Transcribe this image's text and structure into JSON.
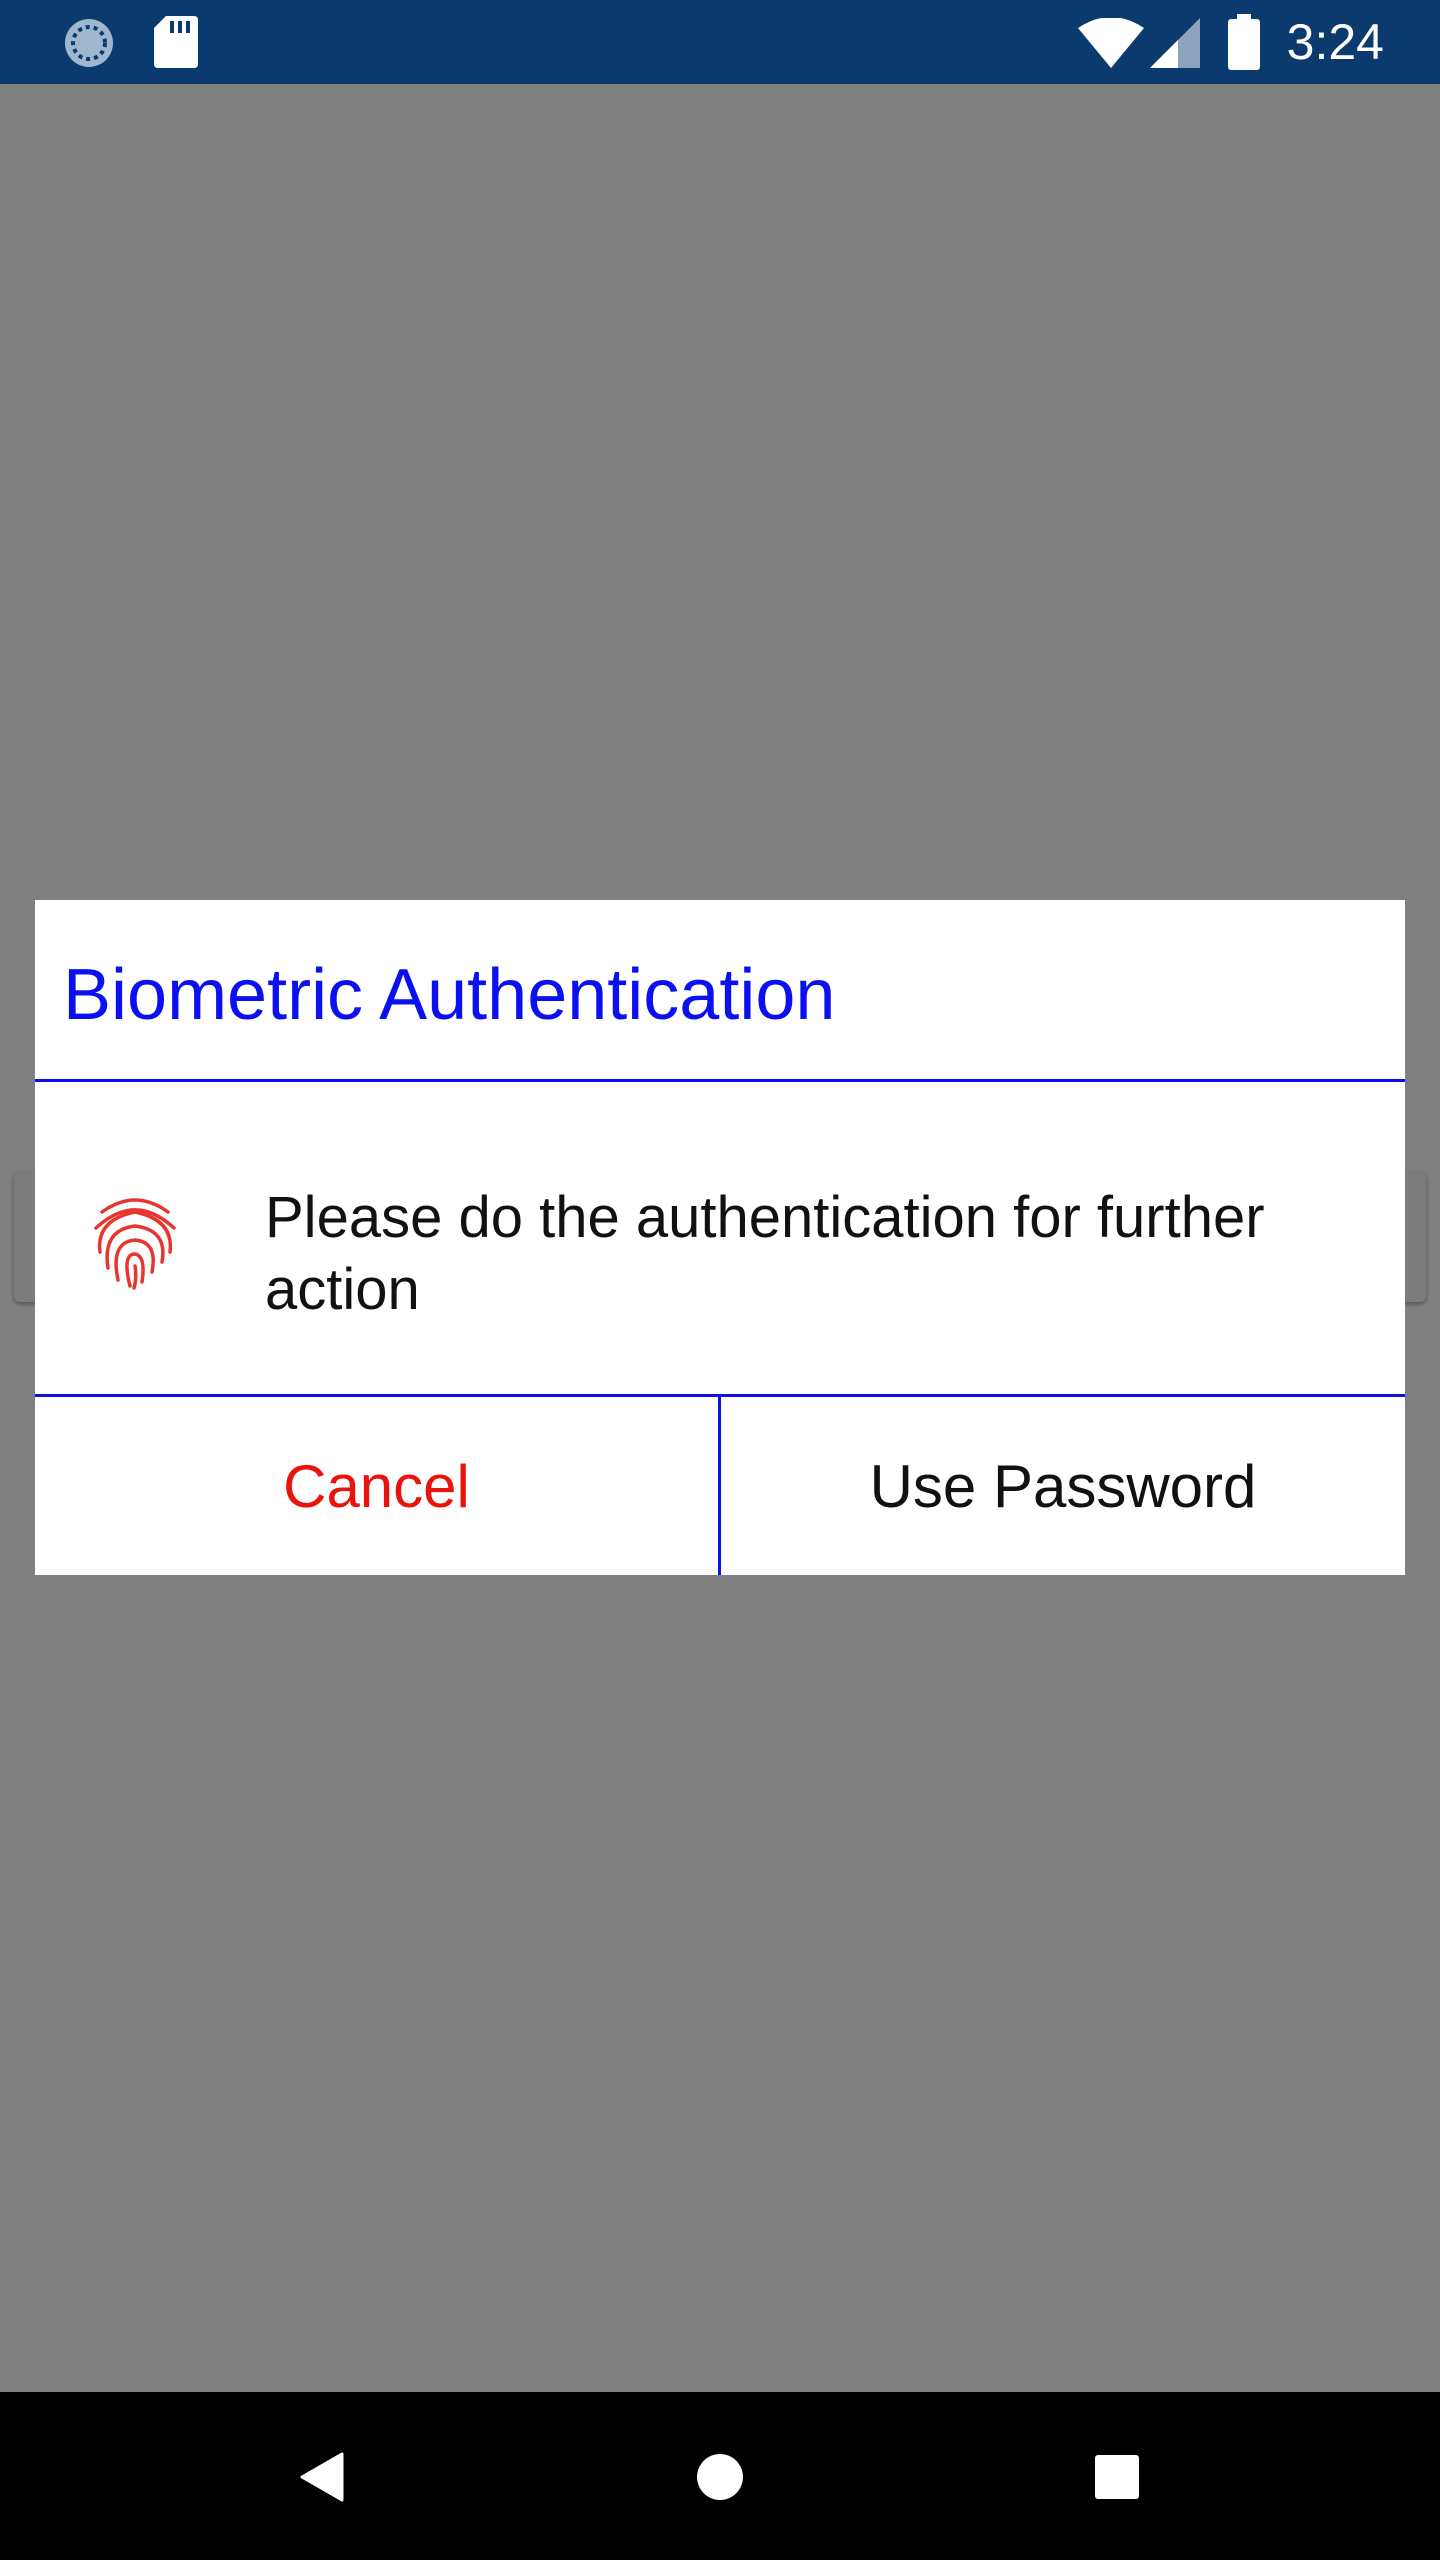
{
  "status_bar": {
    "time": "3:24",
    "icons": [
      "sync-icon",
      "sd-card-icon",
      "wifi-icon",
      "cell-signal-icon",
      "battery-icon"
    ]
  },
  "dialog": {
    "title": "Biometric Authentication",
    "message": "Please do the authentication for further action",
    "icon": "fingerprint-icon",
    "cancel_label": "Cancel",
    "use_password_label": "Use Password"
  },
  "nav_bar": {
    "icons": [
      "back-icon",
      "home-icon",
      "recents-icon"
    ]
  },
  "colors": {
    "status_bar": "#0a3a6e",
    "scrim": "#808080",
    "dialog_accent": "#0a10f0",
    "cancel": "#e8140c",
    "fingerprint": "#e8352e"
  }
}
